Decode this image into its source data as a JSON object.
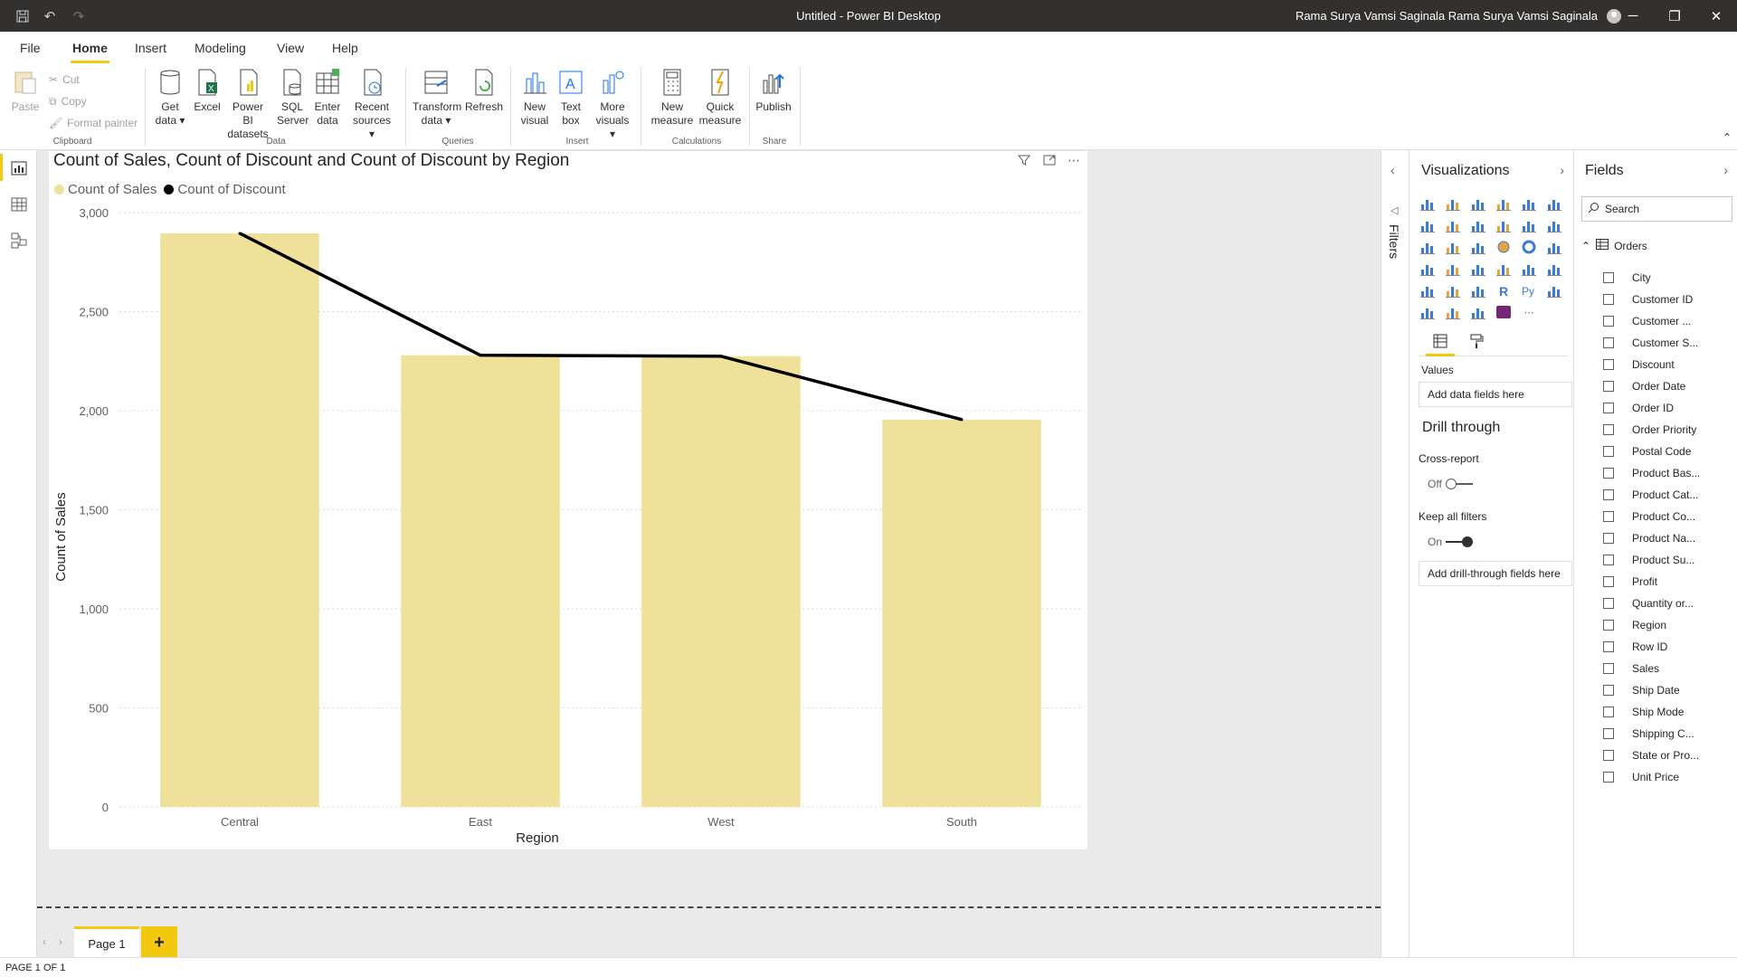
{
  "window": {
    "title": "Untitled - Power BI Desktop",
    "user": "Rama Surya Vamsi Saginala Rama Surya Vamsi Saginala"
  },
  "menu": {
    "tabs": [
      "File",
      "Home",
      "Insert",
      "Modeling",
      "View",
      "Help"
    ],
    "active": "Home"
  },
  "ribbon": {
    "clipboard": {
      "paste": "Paste",
      "cut": "Cut",
      "copy": "Copy",
      "format_painter": "Format painter",
      "group": "Clipboard"
    },
    "data": {
      "get_data": "Get data",
      "excel": "Excel",
      "pbi_datasets": "Power BI datasets",
      "sql_server": "SQL Server",
      "enter_data": "Enter data",
      "recent_sources": "Recent sources",
      "group": "Data"
    },
    "queries": {
      "transform": "Transform data",
      "refresh": "Refresh",
      "group": "Queries"
    },
    "insert": {
      "new_visual": "New visual",
      "text_box": "Text box",
      "more_visuals": "More visuals",
      "group": "Insert"
    },
    "calculations": {
      "new_measure": "New measure",
      "quick_measure": "Quick measure",
      "group": "Calculations"
    },
    "share": {
      "publish": "Publish",
      "group": "Share"
    }
  },
  "visual": {
    "title": "Count of Sales, Count of Discount and Count of Discount by Region",
    "legend": [
      {
        "label": "Count of Sales",
        "color": "#efe09a"
      },
      {
        "label": "Count of Discount",
        "color": "#000000"
      }
    ]
  },
  "chart_data": {
    "type": "bar",
    "title": "Count of Sales, Count of Discount and Count of Discount by Region",
    "xlabel": "Region",
    "ylabel": "Count of Sales",
    "categories": [
      "Central",
      "East",
      "West",
      "South"
    ],
    "series": [
      {
        "name": "Count of Sales",
        "type": "bar",
        "color": "#efe09a",
        "values": [
          2895,
          2280,
          2275,
          1955
        ]
      },
      {
        "name": "Count of Discount",
        "type": "line",
        "color": "#000000",
        "values": [
          2895,
          2280,
          2275,
          1955
        ]
      }
    ],
    "ylim": [
      0,
      3000
    ],
    "yticks": [
      0,
      500,
      1000,
      1500,
      2000,
      2500,
      3000
    ],
    "ytick_labels": [
      "0",
      "500",
      "1,000",
      "1,500",
      "2,000",
      "2,500",
      "3,000"
    ],
    "grid": true,
    "legend_position": "top-left"
  },
  "pages": {
    "tabs": [
      "Page 1"
    ],
    "add": "+",
    "status": "PAGE 1 OF 1"
  },
  "filters": {
    "label": "Filters"
  },
  "visualizations": {
    "title": "Visualizations",
    "values_label": "Values",
    "add_data": "Add data fields here",
    "drill_title": "Drill through",
    "cross_report": "Cross-report",
    "cross_state": "Off",
    "keep_filters": "Keep all filters",
    "keep_state": "On",
    "add_drill": "Add drill-through fields here"
  },
  "fields": {
    "title": "Fields",
    "search_placeholder": "Search",
    "table": "Orders",
    "items": [
      "City",
      "Customer ID",
      "Customer ...",
      "Customer S...",
      "Discount",
      "Order Date",
      "Order ID",
      "Order Priority",
      "Postal Code",
      "Product Bas...",
      "Product Cat...",
      "Product Co...",
      "Product Na...",
      "Product Su...",
      "Profit",
      "Quantity or...",
      "Region",
      "Row ID",
      "Sales",
      "Ship Date",
      "Ship Mode",
      "Shipping C...",
      "State or Pro...",
      "Unit Price"
    ]
  }
}
